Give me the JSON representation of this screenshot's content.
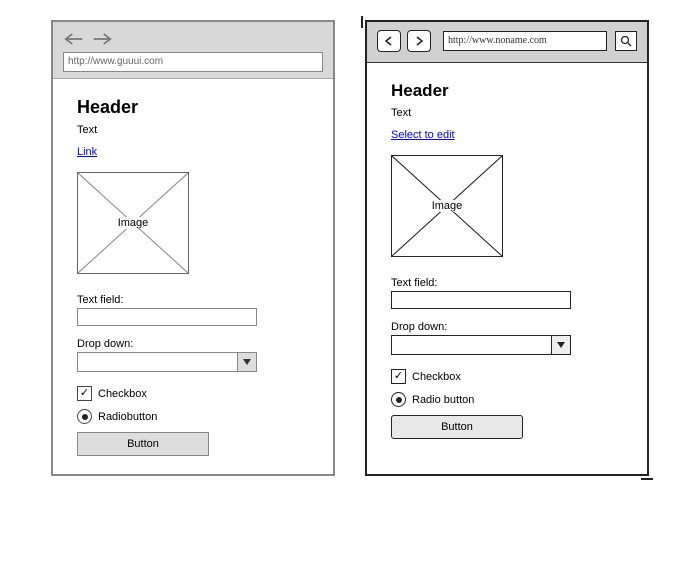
{
  "left": {
    "url": "http://www.guuui.com",
    "header": "Header",
    "text": "Text",
    "link": "Link",
    "image_label": "Image",
    "textfield_label": "Text field:",
    "dropdown_label": "Drop down:",
    "checkbox_label": "Checkbox",
    "radio_label": "Radiobutton",
    "button_label": "Button"
  },
  "right": {
    "url": "http://www.noname.com",
    "header": "Header",
    "text": "Text",
    "link": "Select to edit",
    "image_label": "Image",
    "textfield_label": "Text field:",
    "dropdown_label": "Drop down:",
    "checkbox_label": "Checkbox",
    "radio_label": "Radio button",
    "button_label": "Button"
  }
}
